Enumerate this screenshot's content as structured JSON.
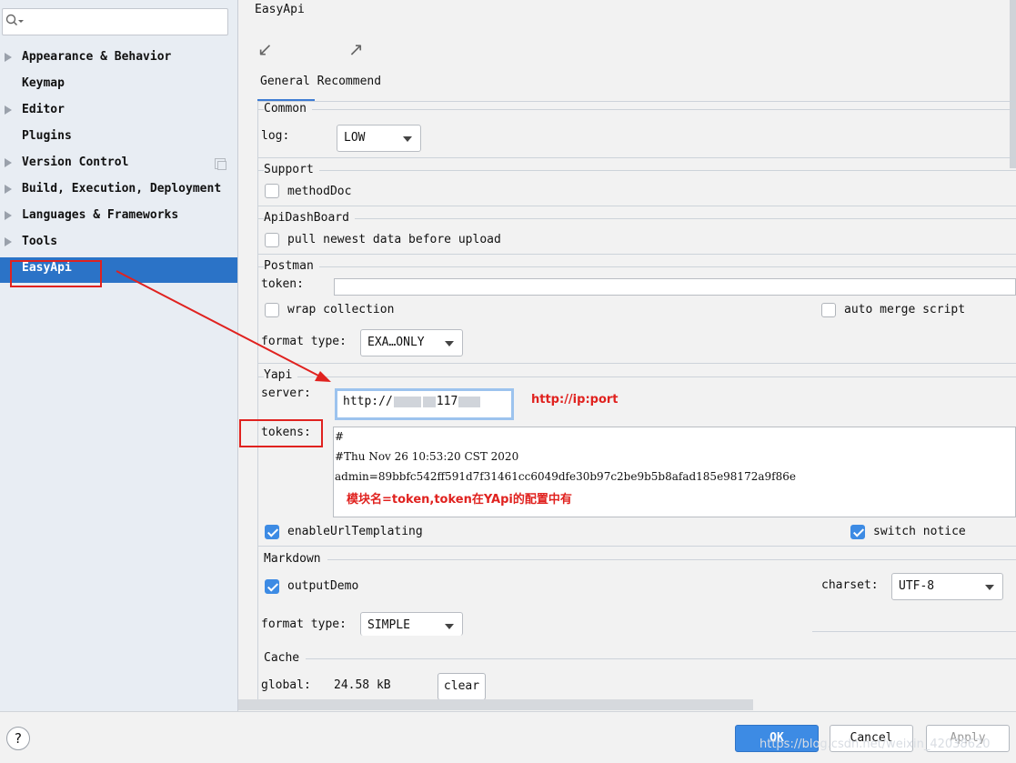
{
  "sidebar": {
    "search_placeholder": "",
    "items": [
      {
        "label": "Appearance & Behavior"
      },
      {
        "label": "Keymap"
      },
      {
        "label": "Editor"
      },
      {
        "label": "Plugins"
      },
      {
        "label": "Version Control"
      },
      {
        "label": "Build, Execution, Deployment"
      },
      {
        "label": "Languages & Frameworks"
      },
      {
        "label": "Tools"
      },
      {
        "label": "EasyApi"
      }
    ]
  },
  "main": {
    "title": "EasyApi",
    "tabs": [
      {
        "label": "General"
      },
      {
        "label": "Recommend"
      }
    ],
    "common": {
      "label": "Common",
      "log_label": "log:",
      "log_value": "LOW"
    },
    "support": {
      "label": "Support",
      "method_doc": "methodDoc"
    },
    "dashboard": {
      "label": "ApiDashBoard",
      "pull": "pull newest data before upload"
    },
    "postman": {
      "label": "Postman",
      "token_label": "token:",
      "wrap": "wrap collection",
      "auto_merge": "auto merge script",
      "format_label": "format type:",
      "format_value": "EXA…ONLY"
    },
    "yapi": {
      "label": "Yapi",
      "server_label": "server:",
      "server_value": "http://",
      "server_value_end": "117",
      "server_hint": "http://ip:port",
      "tokens_label": "tokens:",
      "tokens_lines": [
        "#",
        "#Thu Nov 26 10:53:20 CST 2020",
        "admin=89bbfc542ff591d7f31461cc6049dfe30b97c2be9b5b8afad185e98172a9f86e"
      ],
      "tokens_note": "模块名=token,token在YApi的配置中有",
      "url_templating": "enableUrlTemplating",
      "switch_notice": "switch notice"
    },
    "markdown": {
      "label": "Markdown",
      "output_demo": "outputDemo",
      "charset_label": "charset:",
      "charset_value": "UTF-8",
      "format_label": "format type:",
      "format_value": "SIMPLE"
    },
    "cache": {
      "label": "Cache",
      "global_label": "global:",
      "global_value": "24.58 kB",
      "clear": "clear"
    }
  },
  "footer": {
    "help": "?",
    "ok": "OK",
    "cancel": "Cancel",
    "apply": "Apply",
    "watermark": "https://blog.csdn.net/weixin_42038620"
  },
  "colors": {
    "accent": "#2b73c7",
    "annotation_red": "#e0221f"
  }
}
